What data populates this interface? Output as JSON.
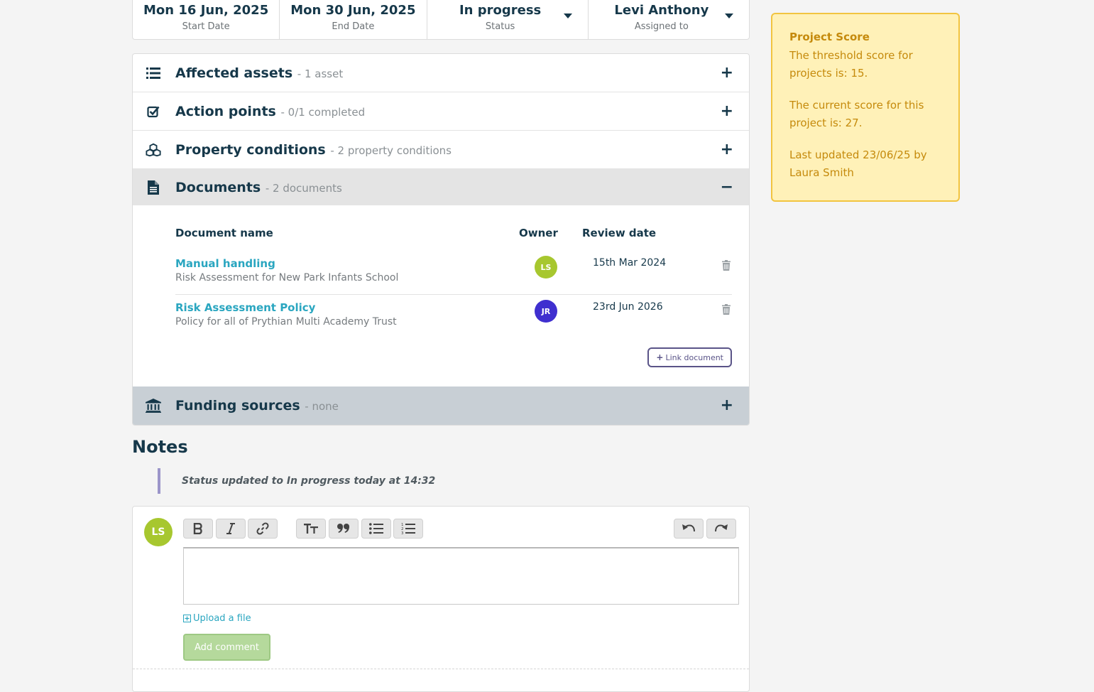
{
  "project_info": {
    "start_date": {
      "value": "Mon 16 Jun, 2025",
      "label": "Start Date"
    },
    "end_date": {
      "value": "Mon 30 Jun, 2025",
      "label": "End Date"
    },
    "status": {
      "value": "In progress",
      "label": "Status"
    },
    "assigned": {
      "value": "Levi Anthony",
      "label": "Assigned to"
    }
  },
  "sections": {
    "affected_assets": {
      "title": "Affected assets",
      "subtitle": "- 1 asset",
      "toggle": "+",
      "icon": "list-icon"
    },
    "action_points": {
      "title": "Action points",
      "subtitle": "- 0/1 completed",
      "toggle": "+",
      "icon": "checkbox-icon"
    },
    "property_conditions": {
      "title": "Property conditions",
      "subtitle": "- 2 property conditions",
      "toggle": "+",
      "icon": "cubes-icon"
    },
    "documents": {
      "title": "Documents",
      "subtitle": "- 2 documents",
      "toggle": "−",
      "icon": "document-icon"
    },
    "funding_sources": {
      "title": "Funding sources",
      "subtitle": "- none",
      "toggle": "+",
      "icon": "bank-icon"
    }
  },
  "documents_table": {
    "headers": {
      "name": "Document name",
      "owner": "Owner",
      "review_date": "Review date"
    },
    "rows": [
      {
        "name": "Manual handling",
        "description": "Risk Assessment for New Park Infants School",
        "owner_initials": "LS",
        "owner_color": "#a7c72f",
        "review_date": "15th Mar 2024"
      },
      {
        "name": "Risk Assessment Policy",
        "description": "Policy for all of Prythian Multi Academy Trust",
        "owner_initials": "JR",
        "owner_color": "#3f2fcf",
        "review_date": "23rd Jun 2026"
      }
    ],
    "link_document_label": "Link document"
  },
  "notes": {
    "title": "Notes",
    "entries": [
      "Status updated to In progress today at 14:32"
    ],
    "composer": {
      "avatar_initials": "LS",
      "editor_value": "",
      "upload_label": "Upload a file",
      "add_comment_label": "Add comment"
    }
  },
  "score_card": {
    "title": "Project Score",
    "threshold_text": "The threshold score for projects is: 15.",
    "current_text": "The current score for this project is: 27.",
    "updated_text": "Last updated 23/06/25 by Laura Smith"
  },
  "colors": {
    "primary_text": "#16384a",
    "link": "#2aa6c0",
    "score_bg": "#fff1b8",
    "score_border": "#f2c440",
    "add_comment_bg": "#b5d99c"
  }
}
